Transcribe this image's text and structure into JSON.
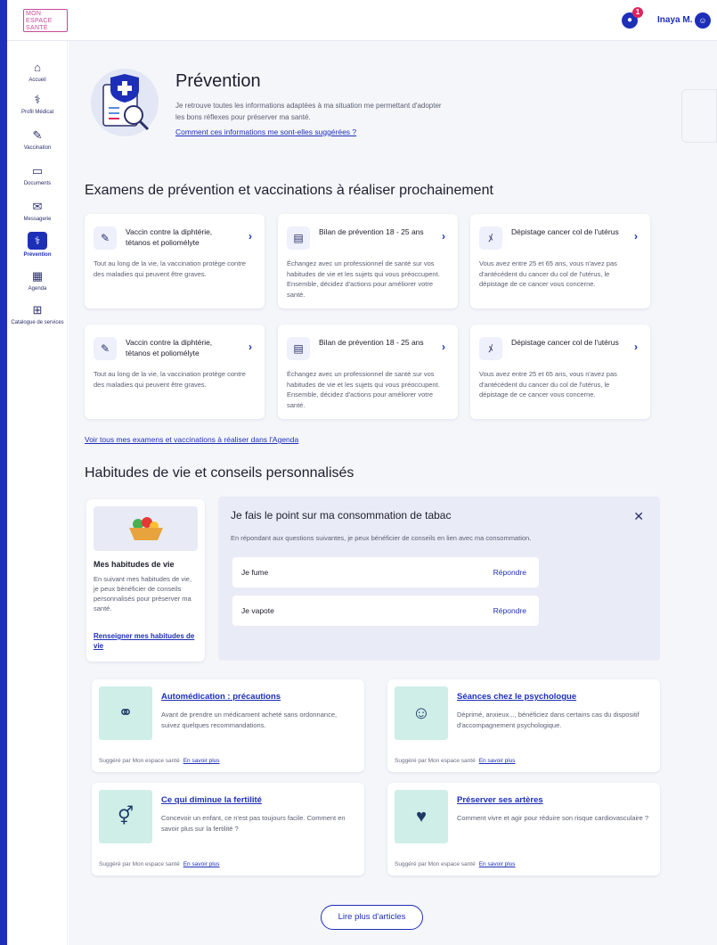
{
  "header": {
    "logo_lines": [
      "MON",
      "ESPACE",
      "SANTÉ"
    ],
    "notif_count": "1",
    "user_name": "Inaya M."
  },
  "nav": {
    "items": [
      {
        "label": "Accueil",
        "icon": "home-icon",
        "glyph": "⌂"
      },
      {
        "label": "Profil Médical",
        "icon": "medical-profile-icon",
        "glyph": "⚕"
      },
      {
        "label": "Vaccination",
        "icon": "syringe-icon",
        "glyph": "✎"
      },
      {
        "label": "Documents",
        "icon": "folder-icon",
        "glyph": "▭"
      },
      {
        "label": "Messagerie",
        "icon": "message-icon",
        "glyph": "✉"
      },
      {
        "label": "Prévention",
        "icon": "stethoscope-icon",
        "glyph": "⚕"
      },
      {
        "label": "Agenda",
        "icon": "calendar-icon",
        "glyph": "▦"
      },
      {
        "label": "Catalogue de services",
        "icon": "grid-icon",
        "glyph": "⊞"
      }
    ]
  },
  "hero": {
    "title": "Prévention",
    "description": "Je retrouve toutes les informations adaptées à ma situation me permettant d'adopter les bons réflexes pour préserver ma santé.",
    "link": "Comment ces informations me sont-elles suggérées ?"
  },
  "exams": {
    "title": "Examens de prévention et vaccinations à réaliser prochainement",
    "cards": [
      {
        "title": "Vaccin contre la diphtérie, tétanos et poliomélyte",
        "desc": "Tout au long de la vie, la vaccination protège contre des maladies qui peuvent être graves.",
        "icon": "syringe-icon",
        "glyph": "✎"
      },
      {
        "title": "Bilan de prévention 18 - 25 ans",
        "desc": "Échangez avec un professionnel de santé sur vos habitudes de vie et les sujets qui vous préoccupent. Ensemble, décidez d'actions pour améliorer votre santé.",
        "icon": "clipboard-icon",
        "glyph": "▤"
      },
      {
        "title": "Dépistage cancer col de l'utérus",
        "desc": "Vous avez entre 25 et 65 ans, vous n'avez pas d'antécédent du cancer du col de l'utérus, le dépistage de ce cancer vous concerne.",
        "icon": "ribbon-icon",
        "glyph": "ﾒ"
      },
      {
        "title": "Vaccin contre la diphtérie, tétanos et poliomélyte",
        "desc": "Tout au long de la vie, la vaccination protège contre des maladies qui peuvent être graves.",
        "icon": "syringe-icon",
        "glyph": "✎"
      },
      {
        "title": "Bilan de prévention 18 - 25 ans",
        "desc": "Échangez avec un professionnel de santé sur vos habitudes de vie et les sujets qui vous préoccupent. Ensemble, décidez d'actions pour améliorer votre santé.",
        "icon": "clipboard-icon",
        "glyph": "▤"
      },
      {
        "title": "Dépistage cancer col de l'utérus",
        "desc": "Vous avez entre 25 et 65 ans, vous n'avez pas d'antécédent du cancer du col de l'utérus, le dépistage de ce cancer vous concerne.",
        "icon": "ribbon-icon",
        "glyph": "ﾒ"
      }
    ],
    "agenda_link": "Voir tous mes examens et vaccinations à réaliser dans l'Agenda"
  },
  "habits": {
    "title": "Habitudes de vie et conseils personnalisés",
    "card_title": "Mes habitudes de vie",
    "card_desc": "En suivant mes habitudes de vie, je peux bénéficier de conseils personnalisés pour préserver ma santé.",
    "card_link": "Renseigner mes habitudes de vie"
  },
  "tabac": {
    "title": "Je fais le point sur ma consommation de tabac",
    "subtitle": "En répondant aux questions suivantes, je peux bénéficier de conseils en lien avec ma consommation.",
    "options": [
      {
        "label": "Je fume",
        "action": "Répondre"
      },
      {
        "label": "Je vapote",
        "action": "Répondre"
      }
    ]
  },
  "articles": [
    {
      "title": "Automédication : précautions",
      "desc": "Avant de prendre un médicament acheté sans ordonnance, suivez quelques recommandations.",
      "footer": "Suggéré par Mon espace santé",
      "more": "En savoir plus",
      "icon": "pills-icon",
      "glyph": "⚭"
    },
    {
      "title": "Séances chez le psychologue",
      "desc": "Déprimé, anxieux..., bénéficiez dans certains cas du dispositif d'accompagnement psychologique.",
      "footer": "Suggéré par Mon espace santé",
      "more": "En savoir plus",
      "icon": "psychology-icon",
      "glyph": "☺"
    },
    {
      "title": "Ce qui diminue la fertilité",
      "desc": "Concevoir un enfant, ce n'est pas toujours facile. Comment en savoir plus sur la fertilité ?",
      "footer": "Suggéré par Mon espace santé",
      "more": "En savoir plus",
      "icon": "gender-icon",
      "glyph": "⚥"
    },
    {
      "title": "Préserver ses artères",
      "desc": "Comment vivre et agir pour réduire son risque cardiovasculaire ?",
      "footer": "Suggéré par Mon espace santé",
      "more": "En savoir plus",
      "icon": "heart-icon",
      "glyph": "♥"
    }
  ],
  "more_button": "Lire plus d'articles",
  "colors": {
    "accent": "#1d2fb8",
    "panel": "#e9ecf6",
    "article_icon_bg": "#cfeee8"
  }
}
